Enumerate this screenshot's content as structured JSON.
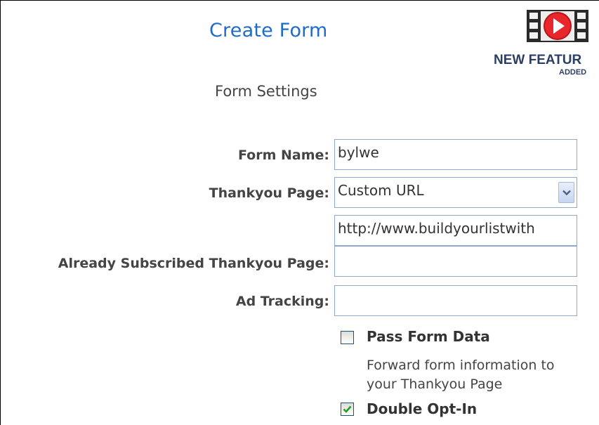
{
  "header": {
    "title": "Create Form",
    "feature_badge": {
      "icon": "video-film-icon",
      "line1": "NEW  FEATUR",
      "line2": "ADDED"
    }
  },
  "section": {
    "title": "Form Settings"
  },
  "form": {
    "form_name": {
      "label": "Form Name:",
      "value": "bylwe"
    },
    "thankyou_page": {
      "label": "Thankyou Page:",
      "selected": "Custom URL",
      "custom_url": "http://www.buildyourlistwith"
    },
    "already_subscribed": {
      "label": "Already Subscribed Thankyou Page:",
      "value": ""
    },
    "ad_tracking": {
      "label": "Ad Tracking:",
      "value": ""
    },
    "pass_form_data": {
      "label": "Pass Form Data",
      "checked": false,
      "help": "Forward form information to your Thankyou Page"
    },
    "double_opt_in": {
      "label": "Double Opt-In",
      "checked": true
    }
  },
  "colors": {
    "title": "#1f6cc7",
    "input_border": "#8ea9cd",
    "badge_red": "#e8262b",
    "checkmark": "#21a121"
  }
}
